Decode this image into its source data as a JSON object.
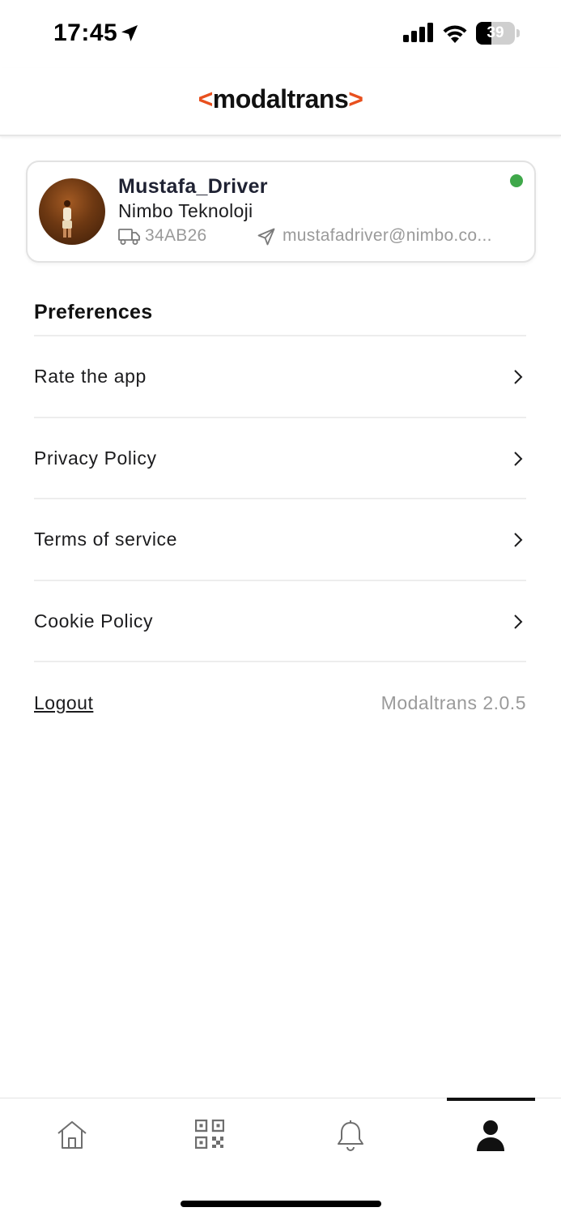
{
  "status_bar": {
    "time": "17:45",
    "battery_level": "39",
    "battery_fraction": 0.39
  },
  "header": {
    "logo_open": "<",
    "logo_text": "modaltrans",
    "logo_close": ">",
    "accent_color": "#e8501e"
  },
  "profile": {
    "name": "Mustafa_Driver",
    "company": "Nimbo Teknoloji",
    "plate": "34AB26",
    "email": "mustafadriver@nimbo.co...",
    "status": "online",
    "status_color": "#3fa84a"
  },
  "preferences": {
    "title": "Preferences",
    "items": [
      {
        "label": "Rate the app"
      },
      {
        "label": "Privacy Policy"
      },
      {
        "label": "Terms of service"
      },
      {
        "label": "Cookie Policy"
      }
    ],
    "logout_label": "Logout",
    "version": "Modaltrans 2.0.5"
  },
  "bottom_nav": {
    "tabs": [
      {
        "icon": "home-icon"
      },
      {
        "icon": "qr-code-icon"
      },
      {
        "icon": "bell-icon"
      },
      {
        "icon": "user-icon",
        "active": true
      }
    ]
  }
}
